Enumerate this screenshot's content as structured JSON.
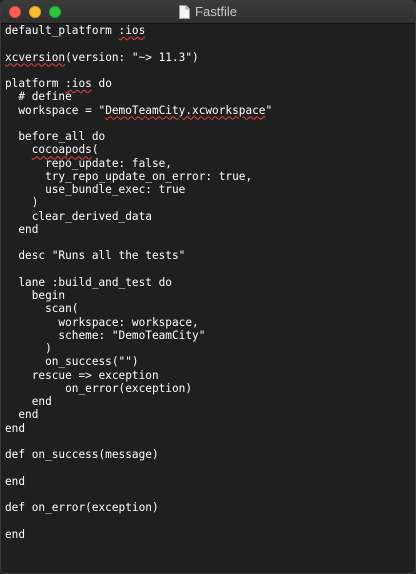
{
  "window": {
    "title": "Fastfile",
    "title_icon": "document-icon",
    "buttons": {
      "close_color": "#fd5f57",
      "minimize_color": "#febc2e",
      "zoom_color": "#28c840"
    }
  },
  "editor": {
    "background": "#1f1f1f",
    "text_color": "#ffffff",
    "spellcheck_color": "#e0443e",
    "lines": [
      [
        {
          "t": "default_platform "
        },
        {
          "t": ":ios",
          "sq": true
        }
      ],
      [],
      [
        {
          "t": "xcversion",
          "sq": true
        },
        {
          "t": "(version: \"~> 11.3\")"
        }
      ],
      [],
      [
        {
          "t": "platform "
        },
        {
          "t": ":ios",
          "sq": true
        },
        {
          "t": " do"
        }
      ],
      [
        {
          "t": "  # define"
        }
      ],
      [
        {
          "t": "  workspace = \""
        },
        {
          "t": "DemoTeamCity.xcworkspace",
          "sq": true
        },
        {
          "t": "\""
        }
      ],
      [],
      [
        {
          "t": "  before_all do"
        }
      ],
      [
        {
          "t": "    "
        },
        {
          "t": "cocoapods",
          "sq": true
        },
        {
          "t": "("
        }
      ],
      [
        {
          "t": "      repo_update: false,"
        }
      ],
      [
        {
          "t": "      try_repo_update_on_error: true,"
        }
      ],
      [
        {
          "t": "      use_bundle_exec: true"
        }
      ],
      [
        {
          "t": "    )"
        }
      ],
      [
        {
          "t": "    clear_derived_data"
        }
      ],
      [
        {
          "t": "  end"
        }
      ],
      [],
      [
        {
          "t": "  desc \"Runs all the tests\""
        }
      ],
      [],
      [
        {
          "t": "  lane :build_and_test do"
        }
      ],
      [
        {
          "t": "    begin"
        }
      ],
      [
        {
          "t": "      scan("
        }
      ],
      [
        {
          "t": "        workspace: workspace,"
        }
      ],
      [
        {
          "t": "        scheme: \"DemoTeamCity\""
        }
      ],
      [
        {
          "t": "      )"
        }
      ],
      [
        {
          "t": "      on_success(\"\")"
        }
      ],
      [
        {
          "t": "    rescue => exception"
        }
      ],
      [
        {
          "t": "         on_error(exception)"
        }
      ],
      [
        {
          "t": "    end"
        }
      ],
      [
        {
          "t": "  end"
        }
      ],
      [
        {
          "t": "end"
        }
      ],
      [],
      [
        {
          "t": "def on_success(message)"
        }
      ],
      [],
      [
        {
          "t": "end"
        }
      ],
      [],
      [
        {
          "t": "def on_error(exception)"
        }
      ],
      [],
      [
        {
          "t": "end"
        }
      ]
    ]
  }
}
